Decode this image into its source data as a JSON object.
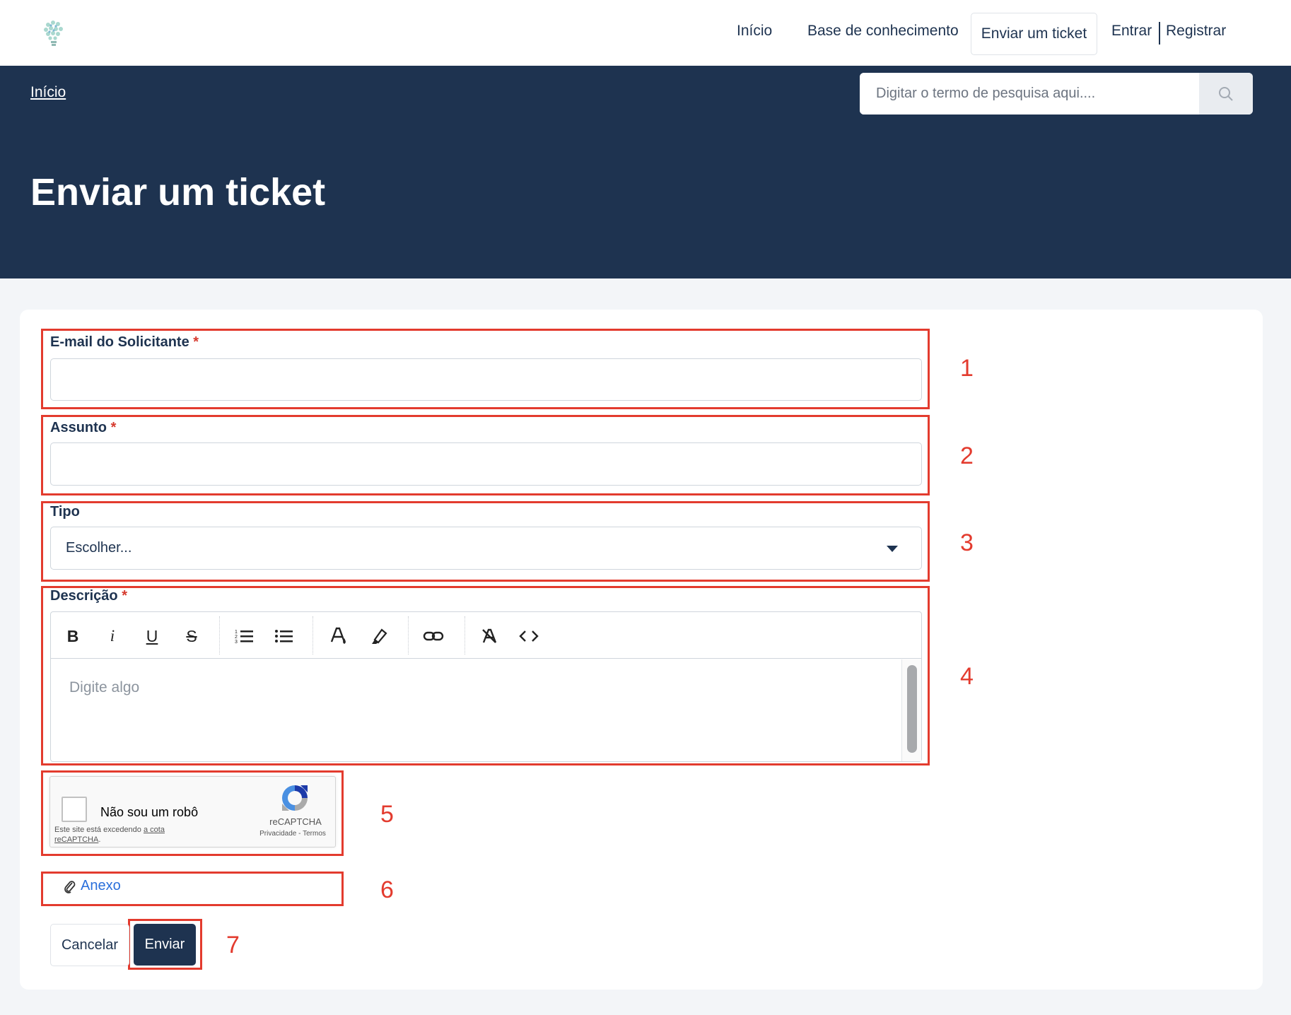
{
  "nav": {
    "logo_icon": "lightbulb-logo-icon",
    "items": [
      {
        "label": "Início"
      },
      {
        "label": "Base de conhecimento"
      },
      {
        "label": "Enviar um ticket"
      },
      {
        "label": "Entrar"
      },
      {
        "label": "Registrar"
      }
    ]
  },
  "banner": {
    "breadcrumb": "Início",
    "search_placeholder": "Digitar o termo de pesquisa aqui....",
    "search_icon": "search-icon",
    "title": "Enviar um ticket",
    "background_color": "#1e3350"
  },
  "annotations": {
    "color": "#e33b2e",
    "numbers": [
      "1",
      "2",
      "3",
      "4",
      "5",
      "6",
      "7"
    ]
  },
  "form": {
    "email": {
      "label": "E-mail do Solicitante",
      "required_mark": "*",
      "value": ""
    },
    "subject": {
      "label": "Assunto",
      "required_mark": "*",
      "value": ""
    },
    "type": {
      "label": "Tipo",
      "selected": "Escolher..."
    },
    "description": {
      "label": "Descrição",
      "required_mark": "*",
      "placeholder": "Digite algo",
      "toolbar": [
        "bold",
        "italic",
        "underline",
        "strikethrough",
        "ordered-list",
        "bullet-list",
        "font-color",
        "highlight",
        "link",
        "clear-format",
        "code-view"
      ],
      "toolbar_glyphs": {
        "bold": "B",
        "italic": "i",
        "underline": "U",
        "strikethrough": "S"
      }
    },
    "captcha": {
      "label": "Não sou um robô",
      "warning_prefix": "Este site está excedendo ",
      "warning_link": "a cota reCAPTCHA",
      "warning_suffix": ".",
      "brand": "reCAPTCHA",
      "privacy": "Privacidade",
      "separator": "-",
      "terms": "Termos"
    },
    "attachment": {
      "label": "Anexo",
      "icon": "paperclip-icon"
    },
    "buttons": {
      "cancel": "Cancelar",
      "submit": "Enviar"
    }
  }
}
